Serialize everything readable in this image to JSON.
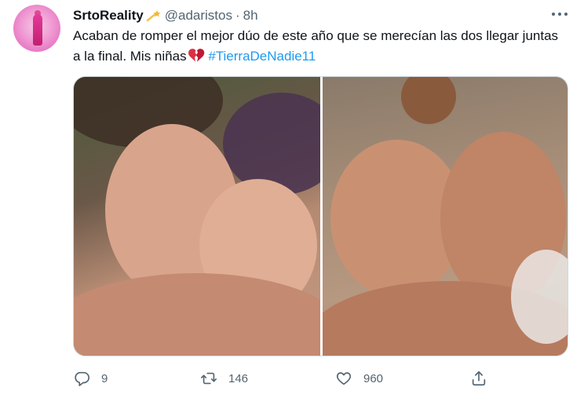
{
  "author": {
    "display_name": "SrtoReality",
    "handle": "@adaristos",
    "separator": "·",
    "time": "8h",
    "badge_icon": "shooting-star-icon"
  },
  "tweet": {
    "text_main": "Acaban de romper el mejor dúo de este año que se merecían las dos llegar juntas a la final. Mis niñas",
    "emoji": "broken-heart-icon",
    "hashtag": "#TierraDeNadie11"
  },
  "media": {
    "photo_count": 2
  },
  "actions": {
    "reply_count": "9",
    "retweet_count": "146",
    "like_count": "960"
  },
  "colors": {
    "accent": "#1d9bf0",
    "secondary_text": "#536471",
    "primary_text": "#0f1419"
  }
}
